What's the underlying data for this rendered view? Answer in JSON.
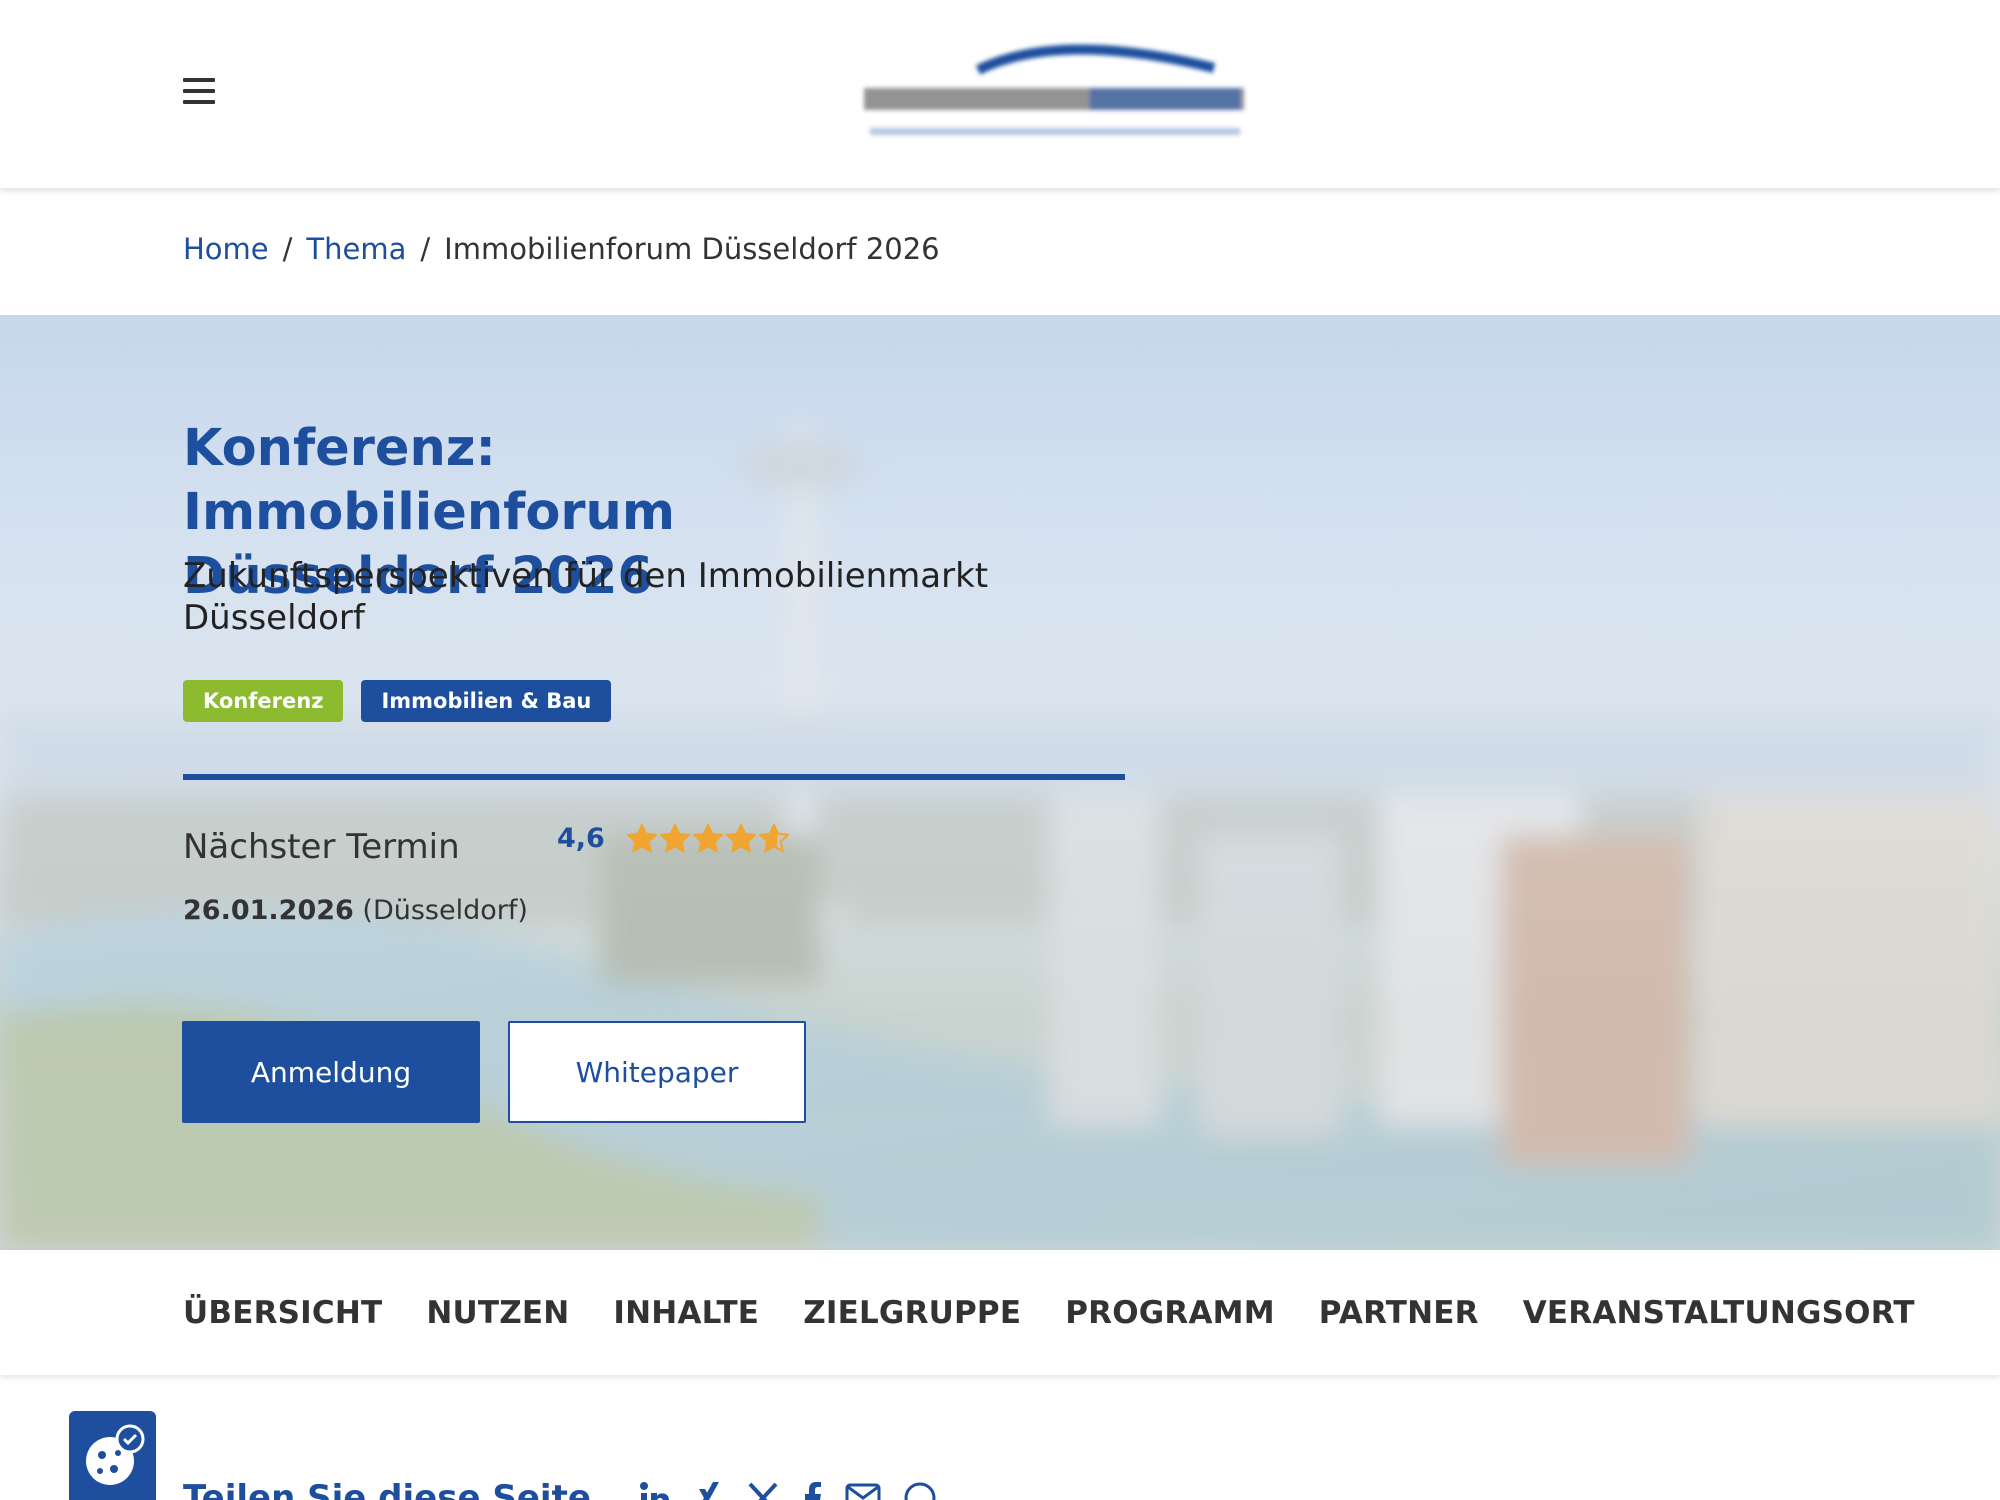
{
  "header": {
    "menu_icon": "hamburger-menu-icon",
    "logo_icon": "company-logo"
  },
  "breadcrumb": {
    "home": "Home",
    "topic": "Thema",
    "separator": "/",
    "current": "Immobilienforum Düsseldorf 2026"
  },
  "hero": {
    "title": "Konferenz: Immobilienforum Düsseldorf 2026",
    "subtitle": "Zukunftsperspektiven für den Immobilienmarkt Düsseldorf",
    "badges": [
      {
        "label": "Konferenz",
        "color": "#8dbb2f"
      },
      {
        "label": "Immobilien & Bau",
        "color": "#1d4f9e"
      }
    ],
    "next_label": "Nächster Termin",
    "rating_value": "4,6",
    "rating_stars": 4.6,
    "rating_max": 5,
    "next_date": "26.01.2026",
    "next_location": "(Düsseldorf)",
    "primary_button": "Anmeldung",
    "secondary_button": "Whitepaper"
  },
  "tabs": [
    "ÜBERSICHT",
    "NUTZEN",
    "INHALTE",
    "ZIELGRUPPE",
    "PROGRAMM",
    "PARTNER",
    "VERANSTALTUNGSORT"
  ],
  "share": {
    "label": "Teilen Sie diese Seite",
    "icons": [
      "linkedin-icon",
      "xing-icon",
      "x-icon",
      "facebook-icon",
      "mail-icon",
      "whatsapp-icon"
    ]
  },
  "cookie": {
    "icon": "cookie-settings-icon"
  },
  "colors": {
    "brand_blue": "#1d4f9e",
    "brand_green": "#8dbb2f",
    "star": "#f0a531"
  }
}
